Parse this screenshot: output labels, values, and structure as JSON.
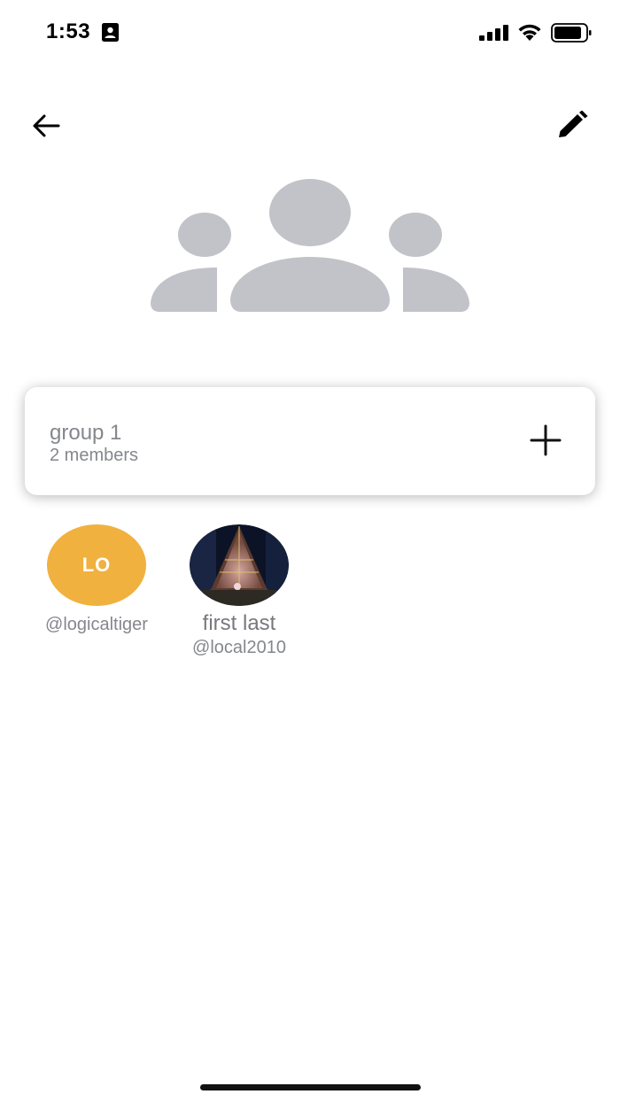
{
  "status_bar": {
    "time": "1:53",
    "icons": [
      "contact-card-icon",
      "cellular-signal-icon",
      "wifi-icon",
      "battery-icon"
    ]
  },
  "app_bar": {
    "back_icon": "arrow-left-icon",
    "edit_icon": "pencil-icon"
  },
  "group": {
    "avatar_icon": "group-people-icon",
    "name": "group 1",
    "members_count": "2 members",
    "add_icon": "plus-icon"
  },
  "members": [
    {
      "initials": "LO",
      "name": "",
      "handle": "@logicaltiger",
      "avatar_color": "#f0b13f"
    },
    {
      "initials": "",
      "name": "first last",
      "handle": "@local2010",
      "avatar": "photo"
    }
  ],
  "colors": {
    "accent_avatar": "#f0b13f",
    "placeholder_gray": "#c2c3c8",
    "secondary_text": "#85878d"
  }
}
